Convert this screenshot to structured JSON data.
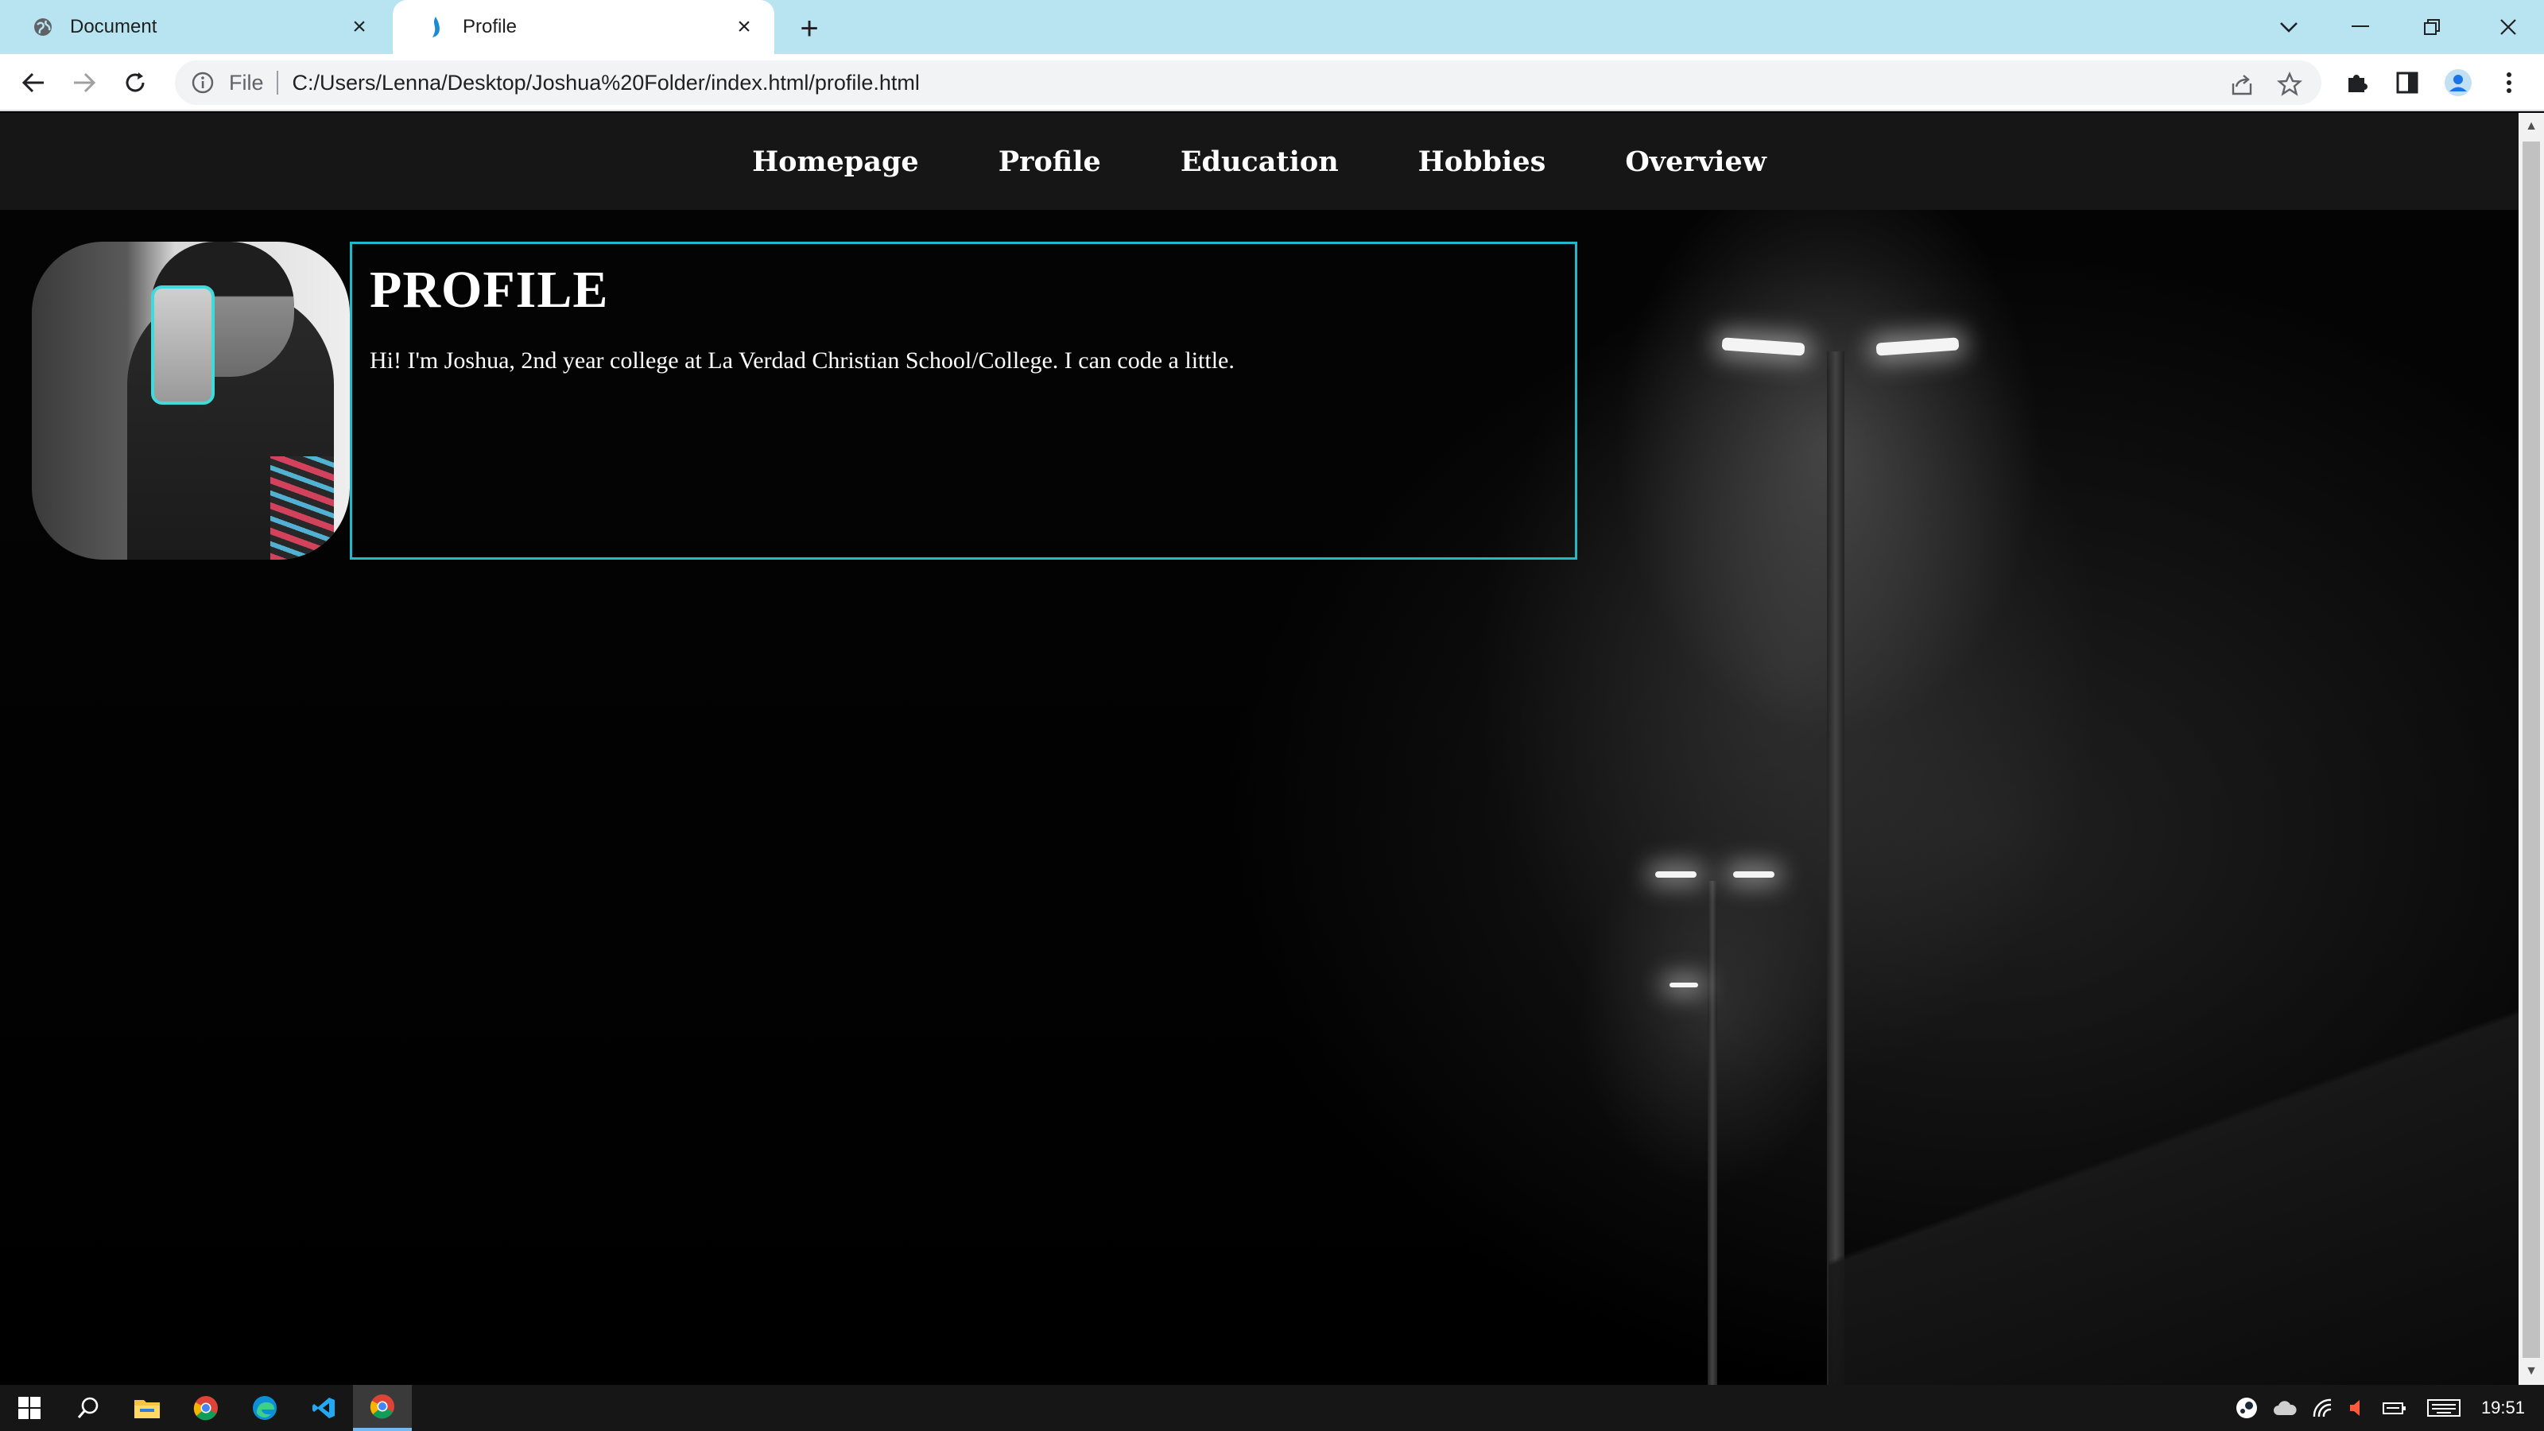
{
  "browser": {
    "tabs": [
      {
        "title": "Document",
        "icon": "globe-icon"
      },
      {
        "title": "Profile",
        "icon": "flame-icon"
      }
    ],
    "address": {
      "scheme_label": "File",
      "url": "C:/Users/Lenna/Desktop/Joshua%20Folder/index.html/profile.html"
    }
  },
  "site": {
    "nav": [
      "Homepage",
      "Profile",
      "Education",
      "Hobbies",
      "Overview"
    ],
    "profile": {
      "heading": "PROFILE",
      "text": "Hi! I'm Joshua, 2nd year college at La Verdad Christian School/College. I can code a little."
    },
    "colors": {
      "box_border": "#1fb9c9",
      "nav_bg": "#161616"
    }
  },
  "taskbar": {
    "apps": [
      "windows-start-icon",
      "search-icon",
      "file-explorer-icon",
      "chrome-icon",
      "edge-icon",
      "vscode-icon",
      "chrome-active-icon"
    ],
    "clock": "19:51"
  }
}
